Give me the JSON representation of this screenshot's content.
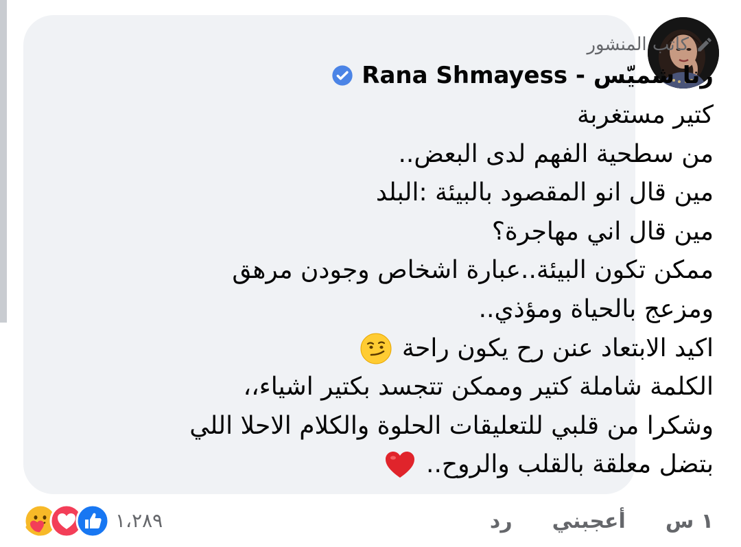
{
  "comment": {
    "author_tag": "كاتب المنشور",
    "author_name": "رنا شميّس - Rana Shmayess",
    "lines": [
      "كتير مستغربة",
      "من سطحية الفهم لدى البعض..",
      "مين قال انو المقصود بالبيئة :البلد",
      "مين قال اني مهاجرة؟",
      "ممكن تكون البيئة..عبارة اشخاص وجودن مرهق",
      "ومزعج بالحياة ومؤذي..",
      "اكيد الابتعاد عنن رح يكون راحة",
      "الكلمة شاملة كتير وممكن تتجسد بكتير اشياء،،",
      "وشكرا من قلبي للتعليقات الحلوة والكلام الاحلا اللي",
      "بتضل معلقة بالقلب والروح.."
    ],
    "emoji": {
      "line_7": "smirking-face-emoji",
      "line_10": "red-heart-emoji"
    }
  },
  "actions": {
    "time": "١ س",
    "like": "أعجبني",
    "reply": "رد"
  },
  "reactions": {
    "count": "١،٢٨٩",
    "icons": [
      "like-reaction-icon",
      "love-reaction-icon",
      "care-reaction-icon"
    ]
  },
  "colors": {
    "bubble": "#f0f2f5",
    "text": "#050505",
    "secondary": "#65676b",
    "like_blue": "#1877f2",
    "love_red": "#f33e58",
    "verified_blue": "#4b84e6"
  }
}
